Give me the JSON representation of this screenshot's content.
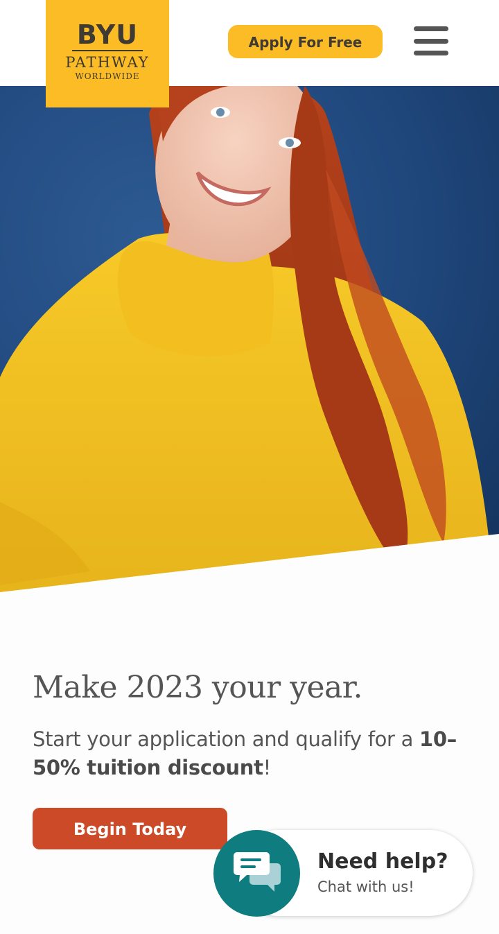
{
  "header": {
    "logo": {
      "line1": "BYU",
      "line2": "PATHWAY",
      "line3": "WORLDWIDE"
    },
    "apply_label": "Apply For Free",
    "menu_icon": "hamburger-menu-icon"
  },
  "hero": {
    "image": "smiling woman with red hair in yellow sweater against blue wall"
  },
  "main": {
    "headline": "Make 2023 your year.",
    "subtext_pre": "Start your application and qualify for a ",
    "subtext_bold": "10–50% tuition discount",
    "subtext_post": "!",
    "begin_label": "Begin Today"
  },
  "chat": {
    "title": "Need help?",
    "subtitle": "Chat with us!",
    "icon": "chat-bubbles-icon"
  },
  "colors": {
    "brand_yellow": "#fcbc25",
    "cta_red": "#cc4a28",
    "chat_teal": "#0f7c80",
    "text_gray": "#555555"
  }
}
